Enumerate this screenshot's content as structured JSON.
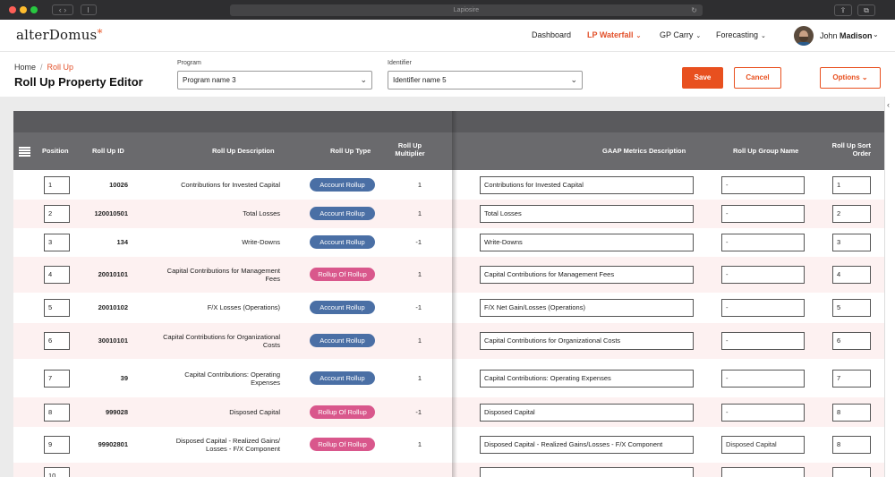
{
  "browser": {
    "url": "Lapiosire",
    "nav_buttons": "‹ ›",
    "reload_icon": "reload-icon",
    "share_glyph": "⇪",
    "tabs_glyph": "⧉"
  },
  "header": {
    "logo_text": "alterDomus",
    "logo_star": "*",
    "nav": [
      {
        "label": "Dashboard",
        "active": false,
        "has_caret": false
      },
      {
        "label": "LP Waterfall",
        "active": true,
        "has_caret": true
      },
      {
        "label": "GP Carry",
        "active": false,
        "has_caret": true
      },
      {
        "label": "Forecasting",
        "active": false,
        "has_caret": true
      }
    ],
    "caret": "⌄",
    "user_first": "John",
    "user_last": "Madison",
    "user_caret": "⌄"
  },
  "editor": {
    "breadcrumb_home": "Home",
    "breadcrumb_sep": "/",
    "breadcrumb_current": "Roll Up",
    "title": "Roll Up Property Editor",
    "program_label": "Program",
    "program_value": "Program name 3",
    "identifier_label": "Identifier",
    "identifier_value": "Identifier name 5",
    "chevron": "⌄",
    "save_label": "Save",
    "cancel_label": "Cancel",
    "options_label": "Options",
    "options_caret": "⌄",
    "collapse_arrow": "‹"
  },
  "table": {
    "columns": {
      "position": "Position",
      "rollup_id": "Roll Up ID",
      "rollup_desc": "Roll Up Description",
      "rollup_type": "Roll Up Type",
      "rollup_mult_1": "Roll Up",
      "rollup_mult_2": "Multiplier",
      "gaap": "GAAP Metrics Description",
      "group": "Roll Up Group Name",
      "sort_1": "Roll Up Sort",
      "sort_2": "Order"
    },
    "colors": {
      "blue_pill": "#4a6fa5",
      "pink_pill": "#d9578c",
      "accent": "#e8501f"
    },
    "rows": [
      {
        "pos": "1",
        "id": "10026",
        "desc1": "Contributions for Invested Capital",
        "desc2": "",
        "type": "Account Rollup",
        "kind": "blue",
        "mult": "1",
        "gaap": "Contributions for Invested Capital",
        "group": "-",
        "sort": "1"
      },
      {
        "pos": "2",
        "id": "120010501",
        "desc1": "Total Losses",
        "desc2": "",
        "type": "Account Rollup",
        "kind": "blue",
        "mult": "1",
        "gaap": "Total Losses",
        "group": "-",
        "sort": "2"
      },
      {
        "pos": "3",
        "id": "134",
        "desc1": "Write-Downs",
        "desc2": "",
        "type": "Account Rollup",
        "kind": "blue",
        "mult": "-1",
        "gaap": "Write-Downs",
        "group": "-",
        "sort": "3"
      },
      {
        "pos": "4",
        "id": "20010101",
        "desc1": "Capital Contributions for Management",
        "desc2": "Fees",
        "type": "Rollup Of Rollup",
        "kind": "pink",
        "mult": "1",
        "gaap": "Capital Contributions for Management Fees",
        "group": "-",
        "sort": "4"
      },
      {
        "pos": "5",
        "id": "20010102",
        "desc1": "F/X Losses (Operations)",
        "desc2": "",
        "type": "Account Rollup",
        "kind": "blue",
        "mult": "-1",
        "gaap": "F/X Net Gain/Losses (Operations)",
        "group": "-",
        "sort": "5"
      },
      {
        "pos": "6",
        "id": "30010101",
        "desc1": "Capital Contributions for Organizational",
        "desc2": "Costs",
        "type": "Account Rollup",
        "kind": "blue",
        "mult": "1",
        "gaap": "Capital Contributions for Organizational Costs",
        "group": "-",
        "sort": "6"
      },
      {
        "pos": "7",
        "id": "39",
        "desc1": "Capital Contributions: Operating",
        "desc2": "Expenses",
        "type": "Account Rollup",
        "kind": "blue",
        "mult": "1",
        "gaap": "Capital Contributions: Operating Expenses",
        "group": "-",
        "sort": "7"
      },
      {
        "pos": "8",
        "id": "999028",
        "desc1": "Disposed Capital",
        "desc2": "",
        "type": "Rollup Of Rollup",
        "kind": "pink",
        "mult": "-1",
        "gaap": "Disposed Capital",
        "group": "-",
        "sort": "8"
      },
      {
        "pos": "9",
        "id": "99902801",
        "desc1": "Disposed Capital - Realized Gains/",
        "desc2": "Losses - F/X Component",
        "type": "Rollup Of Rollup",
        "kind": "pink",
        "mult": "1",
        "gaap": "Disposed Capital - Realized Gains/Losses - F/X Component",
        "group": "Disposed Capital",
        "sort": "8"
      },
      {
        "pos": "10",
        "id": "",
        "desc1": "",
        "desc2": "",
        "type": "",
        "kind": "pink",
        "mult": "",
        "gaap": "",
        "group": "",
        "sort": ""
      }
    ]
  }
}
